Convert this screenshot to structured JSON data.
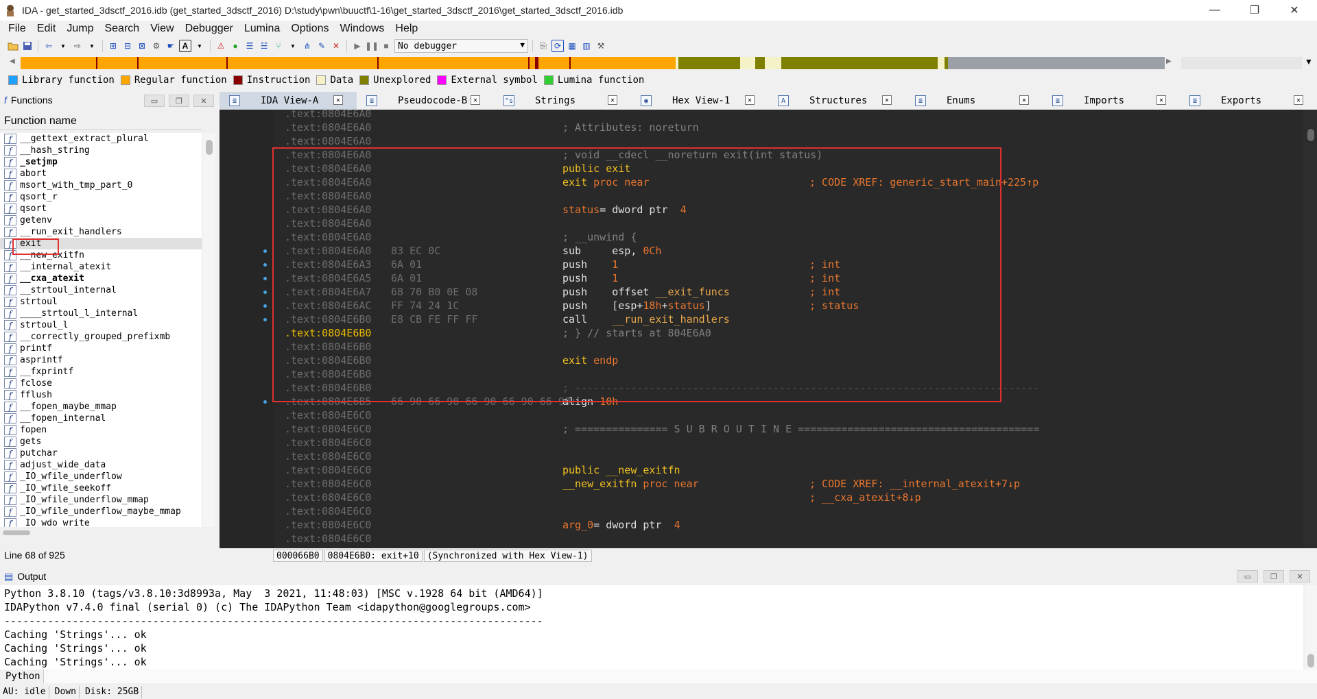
{
  "window": {
    "title": "IDA - get_started_3dsctf_2016.idb (get_started_3dsctf_2016) D:\\study\\pwn\\buuctf\\1-16\\get_started_3dsctf_2016\\get_started_3dsctf_2016.idb",
    "minimize": "—",
    "maximize": "❐",
    "close": "✕"
  },
  "menu": [
    "File",
    "Edit",
    "Jump",
    "Search",
    "View",
    "Debugger",
    "Lumina",
    "Options",
    "Windows",
    "Help"
  ],
  "toolbar": {
    "debugger_value": "No debugger"
  },
  "colors": {
    "library": "#1ea0ff",
    "regular": "#ffa500",
    "instruction": "#8b0000",
    "data": "#f5f2c8",
    "unexplored": "#808000",
    "external": "#ff00ff",
    "lumina": "#32cd32",
    "accent_red": "#e03030"
  },
  "legend": [
    {
      "label": "Library function",
      "color": "#1ea0ff"
    },
    {
      "label": "Regular function",
      "color": "#ffa500"
    },
    {
      "label": "Instruction",
      "color": "#8b0000"
    },
    {
      "label": "Data",
      "color": "#f5f2c8"
    },
    {
      "label": "Unexplored",
      "color": "#808000"
    },
    {
      "label": "External symbol",
      "color": "#ff00ff"
    },
    {
      "label": "Lumina function",
      "color": "#32cd32"
    }
  ],
  "functions_panel": {
    "title": "Functions",
    "column": "Function name",
    "status": "Line 68 of 925",
    "items": [
      {
        "name": "__gettext_extract_plural",
        "bold": false
      },
      {
        "name": "__hash_string",
        "bold": false
      },
      {
        "name": "_setjmp",
        "bold": true
      },
      {
        "name": "abort",
        "bold": false
      },
      {
        "name": "msort_with_tmp_part_0",
        "bold": false
      },
      {
        "name": "qsort_r",
        "bold": false
      },
      {
        "name": "qsort",
        "bold": false
      },
      {
        "name": "getenv",
        "bold": false
      },
      {
        "name": "__run_exit_handlers",
        "bold": false
      },
      {
        "name": "exit",
        "bold": false,
        "selected": true
      },
      {
        "name": "__new_exitfn",
        "bold": false
      },
      {
        "name": "__internal_atexit",
        "bold": false
      },
      {
        "name": "__cxa_atexit",
        "bold": true
      },
      {
        "name": "__strtoul_internal",
        "bold": false
      },
      {
        "name": "strtoul",
        "bold": false
      },
      {
        "name": "____strtoul_l_internal",
        "bold": false
      },
      {
        "name": "strtoul_l",
        "bold": false
      },
      {
        "name": "__correctly_grouped_prefixmb",
        "bold": false
      },
      {
        "name": "printf",
        "bold": false
      },
      {
        "name": "asprintf",
        "bold": false
      },
      {
        "name": "__fxprintf",
        "bold": false
      },
      {
        "name": "fclose",
        "bold": false
      },
      {
        "name": "fflush",
        "bold": false
      },
      {
        "name": "__fopen_maybe_mmap",
        "bold": false
      },
      {
        "name": "__fopen_internal",
        "bold": false
      },
      {
        "name": "fopen",
        "bold": false
      },
      {
        "name": "gets",
        "bold": false
      },
      {
        "name": "putchar",
        "bold": false
      },
      {
        "name": "adjust_wide_data",
        "bold": false
      },
      {
        "name": "_IO_wfile_underflow",
        "bold": false
      },
      {
        "name": "_IO_wfile_seekoff",
        "bold": false
      },
      {
        "name": "_IO_wfile_underflow_mmap",
        "bold": false
      },
      {
        "name": "_IO_wfile_underflow_maybe_mmap",
        "bold": false
      },
      {
        "name": "_IO_wdo_write",
        "bold": false
      }
    ]
  },
  "tabs": [
    {
      "label": "IDA View-A",
      "icon": "≣",
      "active": true
    },
    {
      "label": "Pseudocode-B",
      "icon": "≣",
      "active": false
    },
    {
      "label": "Strings",
      "icon": "\"s",
      "active": false
    },
    {
      "label": "Hex View-1",
      "icon": "◉",
      "active": false
    },
    {
      "label": "Structures",
      "icon": "A",
      "active": false
    },
    {
      "label": "Enums",
      "icon": "≣",
      "active": false
    },
    {
      "label": "Imports",
      "icon": "≣",
      "active": false
    },
    {
      "label": "Exports",
      "icon": "≣",
      "active": false
    }
  ],
  "disasm": [
    {
      "addr": ".text:0804E6A0"
    },
    {
      "addr": ".text:0804E6A0",
      "code": [
        [
          "c-gray",
          "; Attributes: noreturn"
        ]
      ]
    },
    {
      "addr": ".text:0804E6A0"
    },
    {
      "addr": ".text:0804E6A0",
      "code": [
        [
          "c-gray",
          "; void __cdecl __noreturn exit(int status)"
        ]
      ]
    },
    {
      "addr": ".text:0804E6A0",
      "code": [
        [
          "c-yel",
          "public exit"
        ]
      ]
    },
    {
      "addr": ".text:0804E6A0",
      "code": [
        [
          "c-yel",
          "exit"
        ],
        [
          "c-ora",
          " proc near"
        ]
      ],
      "cmt": [
        [
          "c-ora",
          "; CODE XREF: generic_start_main+225↑p"
        ]
      ]
    },
    {
      "addr": ".text:0804E6A0"
    },
    {
      "addr": ".text:0804E6A0",
      "code": [
        [
          "c-ora",
          "status"
        ],
        [
          "c-wht",
          "= dword ptr  "
        ],
        [
          "c-ora",
          "4"
        ]
      ]
    },
    {
      "addr": ".text:0804E6A0"
    },
    {
      "addr": ".text:0804E6A0",
      "code": [
        [
          "c-gray",
          "; __unwind {"
        ]
      ]
    },
    {
      "addr": ".text:0804E6A0",
      "bytes": "83 EC 0C",
      "dot": true,
      "code": [
        [
          "c-wht",
          "sub     esp, "
        ],
        [
          "c-ora",
          "0Ch"
        ]
      ]
    },
    {
      "addr": ".text:0804E6A3",
      "bytes": "6A 01",
      "dot": true,
      "code": [
        [
          "c-wht",
          "push    "
        ],
        [
          "c-ora",
          "1"
        ]
      ],
      "cmt": [
        [
          "c-ora",
          "; int"
        ]
      ]
    },
    {
      "addr": ".text:0804E6A5",
      "bytes": "6A 01",
      "dot": true,
      "code": [
        [
          "c-wht",
          "push    "
        ],
        [
          "c-ora",
          "1"
        ]
      ],
      "cmt": [
        [
          "c-ora",
          "; int"
        ]
      ]
    },
    {
      "addr": ".text:0804E6A7",
      "bytes": "68 70 B0 0E 08",
      "dot": true,
      "code": [
        [
          "c-wht",
          "push    offset "
        ],
        [
          "c-lbl",
          "__exit_funcs"
        ]
      ],
      "cmt": [
        [
          "c-ora",
          "; int"
        ]
      ]
    },
    {
      "addr": ".text:0804E6AC",
      "bytes": "FF 74 24 1C",
      "dot": true,
      "code": [
        [
          "c-wht",
          "push    [esp+"
        ],
        [
          "c-ora",
          "18h"
        ],
        [
          "c-wht",
          "+"
        ],
        [
          "c-ora",
          "status"
        ],
        [
          "c-wht",
          "]"
        ]
      ],
      "cmt": [
        [
          "c-ora",
          "; status"
        ]
      ]
    },
    {
      "addr": ".text:0804E6B0",
      "bytes": "E8 CB FE FF FF",
      "dot": true,
      "code": [
        [
          "c-wht",
          "call    "
        ],
        [
          "c-lbl",
          "__run_exit_handlers"
        ]
      ]
    },
    {
      "addr": ".text:0804E6B0",
      "hl": true,
      "code": [
        [
          "c-gray",
          "; } // starts at 804E6A0"
        ]
      ]
    },
    {
      "addr": ".text:0804E6B0"
    },
    {
      "addr": ".text:0804E6B0",
      "code": [
        [
          "c-yel",
          "exit"
        ],
        [
          "c-ora",
          " endp"
        ]
      ]
    },
    {
      "addr": ".text:0804E6B0"
    },
    {
      "addr": ".text:0804E6B0",
      "code": [
        [
          "c-sep",
          "; ---------------------------------------------------------------------------"
        ]
      ]
    },
    {
      "addr": ".text:0804E6B5",
      "bytes": "66 90 66 90 66 90 66 90 66 90+",
      "dot": true,
      "code": [
        [
          "c-wht",
          "align "
        ],
        [
          "c-ora",
          "10h"
        ]
      ]
    },
    {
      "addr": ".text:0804E6C0"
    },
    {
      "addr": ".text:0804E6C0",
      "code": [
        [
          "c-gray",
          "; =============== S U B R O U T I N E ======================================="
        ]
      ]
    },
    {
      "addr": ".text:0804E6C0"
    },
    {
      "addr": ".text:0804E6C0"
    },
    {
      "addr": ".text:0804E6C0",
      "code": [
        [
          "c-yel",
          "public __new_exitfn"
        ]
      ]
    },
    {
      "addr": ".text:0804E6C0",
      "code": [
        [
          "c-yel",
          "__new_exitfn"
        ],
        [
          "c-ora",
          " proc near"
        ]
      ],
      "cmt": [
        [
          "c-ora",
          "; CODE XREF: __internal_atexit+7↓p"
        ]
      ]
    },
    {
      "addr": ".text:0804E6C0",
      "cmt": [
        [
          "c-ora",
          "; __cxa_atexit+8↓p"
        ]
      ]
    },
    {
      "addr": ".text:0804E6C0"
    },
    {
      "addr": ".text:0804E6C0",
      "code": [
        [
          "c-ora",
          "arg_0"
        ],
        [
          "c-wht",
          "= dword ptr  "
        ],
        [
          "c-ora",
          "4"
        ]
      ]
    },
    {
      "addr": ".text:0804E6C0"
    }
  ],
  "disasm_status": [
    "000066B0",
    "0804E6B0: exit+10",
    "(Synchronized with Hex View-1)"
  ],
  "output": {
    "title": "Output",
    "lines": [
      "Python 3.8.10 (tags/v3.8.10:3d8993a, May  3 2021, 11:48:03) [MSC v.1928 64 bit (AMD64)]",
      "IDAPython v7.4.0 final (serial 0) (c) The IDAPython Team <idapython@googlegroups.com>",
      "---------------------------------------------------------------------------------------",
      "Caching 'Strings'... ok",
      "Caching 'Strings'... ok",
      "Caching 'Strings'... ok"
    ]
  },
  "python_label": "Python",
  "statusbar": [
    "AU:  idle",
    "Down",
    "Disk: 25GB"
  ]
}
